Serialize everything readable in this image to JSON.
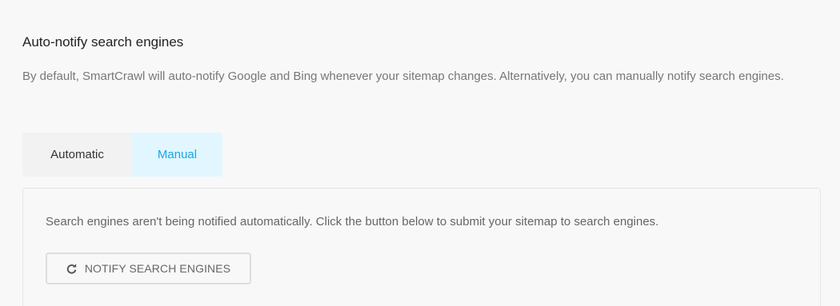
{
  "section": {
    "title": "Auto-notify search engines",
    "description": "By default, SmartCrawl will auto-notify Google and Bing whenever your sitemap changes. Alternatively, you can manually notify search engines."
  },
  "tabs": [
    {
      "label": "Automatic",
      "active": false
    },
    {
      "label": "Manual",
      "active": true
    }
  ],
  "panel": {
    "text": "Search engines aren't being notified automatically. Click the button below to submit your sitemap to search engines.",
    "button_label": "NOTIFY SEARCH ENGINES",
    "button_icon": "refresh-icon"
  },
  "colors": {
    "accent": "#17a8e3",
    "active_tab_bg": "#e1f6ff",
    "inactive_tab_bg": "#f2f2f2"
  }
}
